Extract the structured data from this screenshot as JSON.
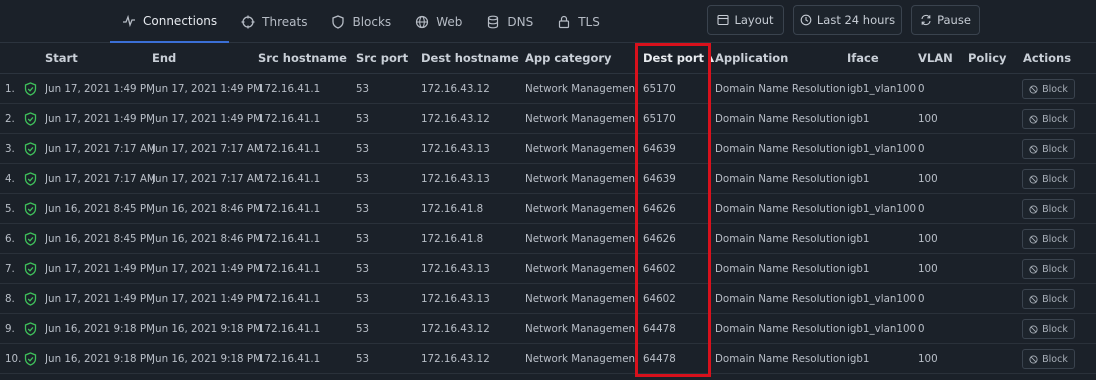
{
  "tabs": [
    {
      "label": "Connections",
      "icon": "activity-icon",
      "active": true
    },
    {
      "label": "Threats",
      "icon": "crosshair-icon"
    },
    {
      "label": "Blocks",
      "icon": "shield-icon"
    },
    {
      "label": "Web",
      "icon": "globe-icon"
    },
    {
      "label": "DNS",
      "icon": "database-icon"
    },
    {
      "label": "TLS",
      "icon": "lock-icon"
    }
  ],
  "toolbar": {
    "layout_label": "Layout",
    "range_label": "Last 24 hours",
    "pause_label": "Pause"
  },
  "columns": [
    "Start",
    "End",
    "Src hostname",
    "Src port",
    "Dest hostname",
    "App category",
    "Dest port",
    "Application",
    "Iface",
    "VLAN",
    "Policy",
    "Actions"
  ],
  "sort": {
    "column": "Dest port",
    "direction": "ascending"
  },
  "block_label": "Block",
  "status_color": "#3fbf5a",
  "highlight_color": "#d8111c",
  "rows": [
    {
      "n": "1.",
      "start": "Jun 17, 2021 1:49 PM",
      "end": "Jun 17, 2021 1:49 PM",
      "src": "172.16.41.1",
      "sport": "53",
      "dest": "172.16.43.12",
      "cat": "Network Management",
      "dport": "65170",
      "app": "Domain Name Resolution",
      "iface": "igb1_vlan100",
      "vlan": "0"
    },
    {
      "n": "2.",
      "start": "Jun 17, 2021 1:49 PM",
      "end": "Jun 17, 2021 1:49 PM",
      "src": "172.16.41.1",
      "sport": "53",
      "dest": "172.16.43.12",
      "cat": "Network Management",
      "dport": "65170",
      "app": "Domain Name Resolution",
      "iface": "igb1",
      "vlan": "100"
    },
    {
      "n": "3.",
      "start": "Jun 17, 2021 7:17 AM",
      "end": "Jun 17, 2021 7:17 AM",
      "src": "172.16.41.1",
      "sport": "53",
      "dest": "172.16.43.13",
      "cat": "Network Management",
      "dport": "64639",
      "app": "Domain Name Resolution",
      "iface": "igb1_vlan100",
      "vlan": "0"
    },
    {
      "n": "4.",
      "start": "Jun 17, 2021 7:17 AM",
      "end": "Jun 17, 2021 7:17 AM",
      "src": "172.16.41.1",
      "sport": "53",
      "dest": "172.16.43.13",
      "cat": "Network Management",
      "dport": "64639",
      "app": "Domain Name Resolution",
      "iface": "igb1",
      "vlan": "100"
    },
    {
      "n": "5.",
      "start": "Jun 16, 2021 8:45 PM",
      "end": "Jun 16, 2021 8:46 PM",
      "src": "172.16.41.1",
      "sport": "53",
      "dest": "172.16.41.8",
      "cat": "Network Management",
      "dport": "64626",
      "app": "Domain Name Resolution",
      "iface": "igb1_vlan100",
      "vlan": "0"
    },
    {
      "n": "6.",
      "start": "Jun 16, 2021 8:45 PM",
      "end": "Jun 16, 2021 8:46 PM",
      "src": "172.16.41.1",
      "sport": "53",
      "dest": "172.16.41.8",
      "cat": "Network Management",
      "dport": "64626",
      "app": "Domain Name Resolution",
      "iface": "igb1",
      "vlan": "100"
    },
    {
      "n": "7.",
      "start": "Jun 17, 2021 1:49 PM",
      "end": "Jun 17, 2021 1:49 PM",
      "src": "172.16.41.1",
      "sport": "53",
      "dest": "172.16.43.13",
      "cat": "Network Management",
      "dport": "64602",
      "app": "Domain Name Resolution",
      "iface": "igb1",
      "vlan": "100"
    },
    {
      "n": "8.",
      "start": "Jun 17, 2021 1:49 PM",
      "end": "Jun 17, 2021 1:49 PM",
      "src": "172.16.41.1",
      "sport": "53",
      "dest": "172.16.43.13",
      "cat": "Network Management",
      "dport": "64602",
      "app": "Domain Name Resolution",
      "iface": "igb1_vlan100",
      "vlan": "0"
    },
    {
      "n": "9.",
      "start": "Jun 16, 2021 9:18 PM",
      "end": "Jun 16, 2021 9:18 PM",
      "src": "172.16.41.1",
      "sport": "53",
      "dest": "172.16.43.12",
      "cat": "Network Management",
      "dport": "64478",
      "app": "Domain Name Resolution",
      "iface": "igb1_vlan100",
      "vlan": "0"
    },
    {
      "n": "10.",
      "start": "Jun 16, 2021 9:18 PM",
      "end": "Jun 16, 2021 9:18 PM",
      "src": "172.16.41.1",
      "sport": "53",
      "dest": "172.16.43.12",
      "cat": "Network Management",
      "dport": "64478",
      "app": "Domain Name Resolution",
      "iface": "igb1",
      "vlan": "100"
    }
  ]
}
